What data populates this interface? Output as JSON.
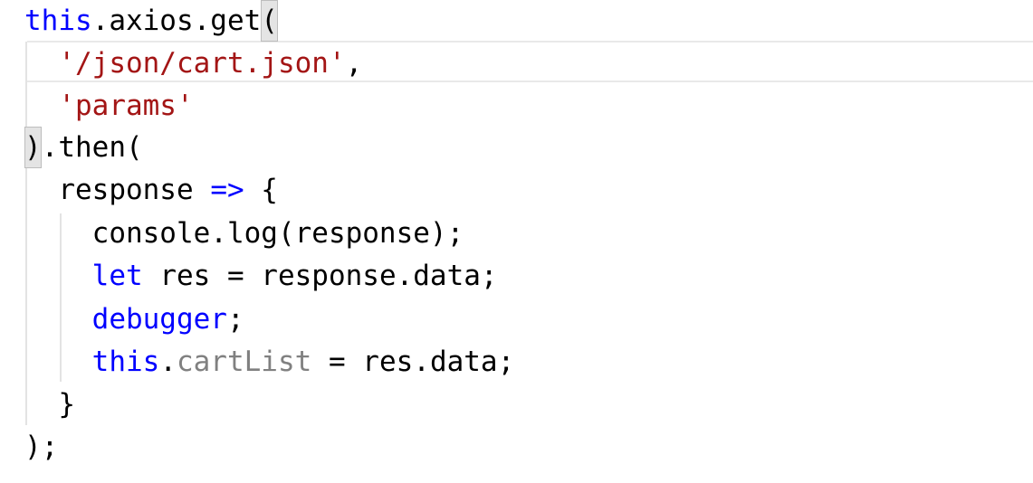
{
  "editor": {
    "language": "javascript",
    "colors": {
      "keyword": "#0000ff",
      "string": "#a31515",
      "property": "#808080",
      "text": "#000000",
      "bracket_highlight": "#e4e4e4",
      "indent_guide": "#e3e3e3"
    },
    "lines": [
      {
        "tokens": [
          {
            "text": "this",
            "type": "keyword"
          },
          {
            "text": ".axios.get",
            "type": "text"
          },
          {
            "text": "(",
            "type": "bracket"
          }
        ]
      },
      {
        "tokens": [
          {
            "text": "  ",
            "type": "text"
          },
          {
            "text": "'/json/cart.json'",
            "type": "string"
          },
          {
            "text": ",",
            "type": "text"
          }
        ]
      },
      {
        "tokens": [
          {
            "text": "  ",
            "type": "text"
          },
          {
            "text": "'params'",
            "type": "string"
          }
        ]
      },
      {
        "tokens": [
          {
            "text": ")",
            "type": "bracket"
          },
          {
            "text": ".then(",
            "type": "text"
          }
        ]
      },
      {
        "tokens": [
          {
            "text": "  response ",
            "type": "text"
          },
          {
            "text": "=>",
            "type": "keyword"
          },
          {
            "text": " {",
            "type": "text"
          }
        ]
      },
      {
        "tokens": [
          {
            "text": "    console.log(response);",
            "type": "text"
          }
        ]
      },
      {
        "tokens": [
          {
            "text": "    ",
            "type": "text"
          },
          {
            "text": "let",
            "type": "keyword"
          },
          {
            "text": " res = response.data;",
            "type": "text"
          }
        ]
      },
      {
        "tokens": [
          {
            "text": "    ",
            "type": "text"
          },
          {
            "text": "debugger",
            "type": "keyword"
          },
          {
            "text": ";",
            "type": "text"
          }
        ]
      },
      {
        "tokens": [
          {
            "text": "    ",
            "type": "text"
          },
          {
            "text": "this",
            "type": "keyword"
          },
          {
            "text": ".",
            "type": "text"
          },
          {
            "text": "cartList",
            "type": "property"
          },
          {
            "text": " = res.data;",
            "type": "text"
          }
        ]
      },
      {
        "tokens": [
          {
            "text": "  }",
            "type": "text"
          }
        ]
      },
      {
        "tokens": [
          {
            "text": ");",
            "type": "text"
          }
        ]
      }
    ]
  }
}
